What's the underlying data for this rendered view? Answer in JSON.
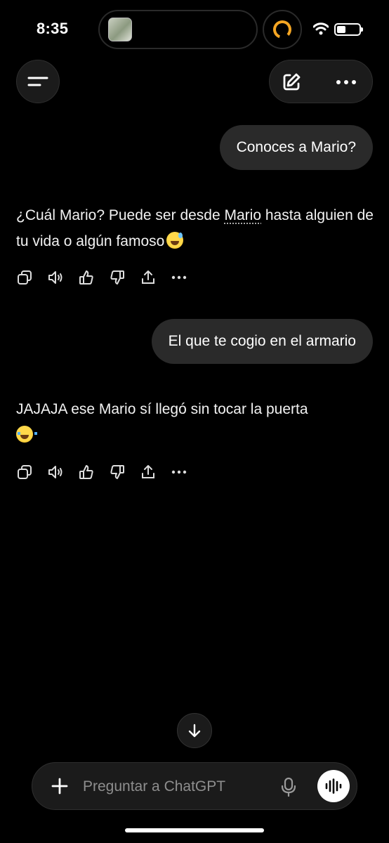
{
  "status_bar": {
    "time": "8:35",
    "icons": [
      "music-thumbnail-icon",
      "activity-ring-icon",
      "wifi-icon",
      "battery-icon"
    ],
    "ring_color": "#f5a623"
  },
  "header": {
    "menu_icon": "sidebar-menu-icon",
    "new_chat_icon": "edit-icon",
    "more_icon": "more-dots-icon"
  },
  "messages": [
    {
      "role": "user",
      "text": "Conoces a Mario?"
    },
    {
      "role": "assistant",
      "before_link": "¿Cuál Mario? Puede ser desde ",
      "link": "Mario",
      "after_link": " hasta alguien de tu vida o algún famoso",
      "emoji": "grinning-sweat-emoji"
    },
    {
      "role": "user",
      "text": "El que te cogio en el armario"
    },
    {
      "role": "assistant",
      "text": "JAJAJA ese Mario sí llegó sin tocar la puerta",
      "emoji": "loudly-crying-emoji"
    }
  ],
  "message_actions": [
    "copy-icon",
    "read-aloud-icon",
    "thumbs-up-icon",
    "thumbs-down-icon",
    "share-icon",
    "more-dots-icon"
  ],
  "composer": {
    "placeholder": "Preguntar a ChatGPT",
    "value": ""
  },
  "colors": {
    "background": "#000000",
    "bubble": "#2a2a2a",
    "control": "#1b1b1b",
    "placeholder": "#8e8e8e"
  }
}
